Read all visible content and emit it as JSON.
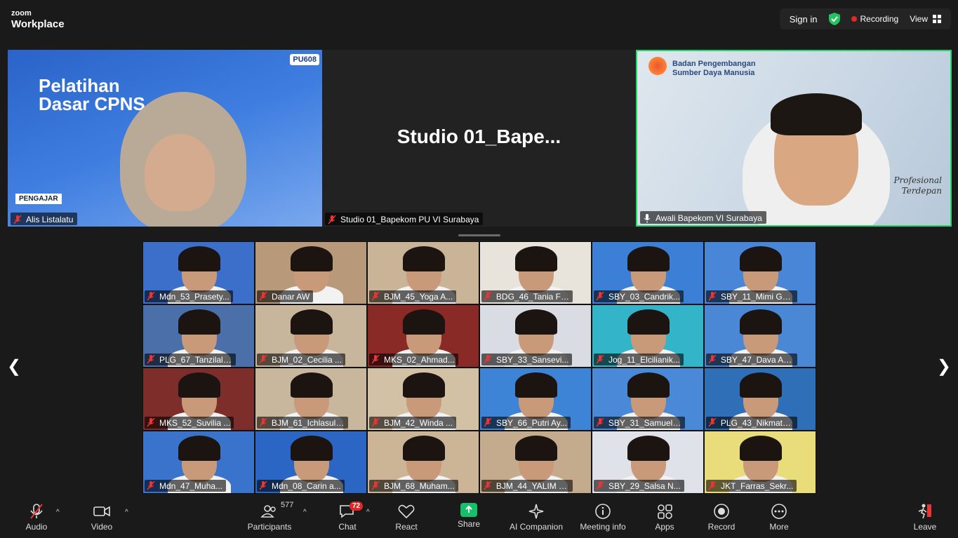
{
  "app": {
    "logo_line1": "zoom",
    "logo_line2": "Workplace",
    "sign_in": "Sign in",
    "recording": "Recording",
    "view": "View"
  },
  "speakers": [
    {
      "name": "Alis Listalatu",
      "poster_title_1": "Pelatihan",
      "poster_title_2": "Dasar CPNS",
      "poster_badge": "PU608",
      "poster_tag": "PENGAJAR"
    },
    {
      "name": "Studio 01_Bapekom PU VI Surabaya",
      "display": "Studio  01_Bape..."
    },
    {
      "name": "Awali Bapekom VI Surabaya",
      "org_1": "Badan Pengembangan",
      "org_2": "Sumber Daya Manusia",
      "tagline_1": "Profesional",
      "tagline_2": "Terdepan"
    }
  ],
  "gallery": [
    {
      "name": "Mdn_53_Prasety...",
      "bg": "#3b6fc9"
    },
    {
      "name": "Danar AW",
      "bg": "#b89a7a"
    },
    {
      "name": "BJM_45_Yoga A...",
      "bg": "#c9b498"
    },
    {
      "name": "BDG_46_Tania Fi...",
      "bg": "#e8e4dc"
    },
    {
      "name": "SBY_03_Candrik...",
      "bg": "#3b7fd6"
    },
    {
      "name": "SBY_11_Mimi Gu...",
      "bg": "#4a86d8"
    },
    {
      "name": "PLG_67_Tanzilal ...",
      "bg": "#4b6fa8"
    },
    {
      "name": "BJM_02_Cecilia ...",
      "bg": "#c8b69c"
    },
    {
      "name": "MKS_02_Ahmad...",
      "bg": "#8a2a26"
    },
    {
      "name": "SBY_33_Sansevi...",
      "bg": "#d9dde3"
    },
    {
      "name": "Jog_11_Elcilianik...",
      "bg": "#34b4c8"
    },
    {
      "name": "SBY_47_Dava Az...",
      "bg": "#4a88d6"
    },
    {
      "name": "MKS_52_Suvilia ...",
      "bg": "#7d2e2a"
    },
    {
      "name": "BJM_61_Ichlasul ...",
      "bg": "#c9b79d"
    },
    {
      "name": "BJM_42_Winda ...",
      "bg": "#d2c1a4"
    },
    {
      "name": "SBY_66_Putri Ay...",
      "bg": "#3d83d6"
    },
    {
      "name": "SBY_31_Samuel ...",
      "bg": "#4a89d8"
    },
    {
      "name": "PLG_43_Nikmatu...",
      "bg": "#2f6fb8"
    },
    {
      "name": "Mdn_47_Muha...",
      "bg": "#3a73cc"
    },
    {
      "name": "Mdn_08_Carin a...",
      "bg": "#2b66c4"
    },
    {
      "name": "BJM_68_Muham...",
      "bg": "#cbb596"
    },
    {
      "name": "BJM_44_YALIM F...",
      "bg": "#c4ab8d"
    },
    {
      "name": "SBY_29_Salsa N...",
      "bg": "#dfe2e8"
    },
    {
      "name": "JKT_Farras_Sekr...",
      "bg": "#e9dc7a"
    }
  ],
  "toolbar": {
    "audio": "Audio",
    "video": "Video",
    "participants": "Participants",
    "participants_count": "577",
    "chat": "Chat",
    "chat_badge": "72",
    "react": "React",
    "share": "Share",
    "ai_companion": "AI Companion",
    "meeting_info": "Meeting info",
    "apps": "Apps",
    "record": "Record",
    "more": "More",
    "leave": "Leave"
  }
}
